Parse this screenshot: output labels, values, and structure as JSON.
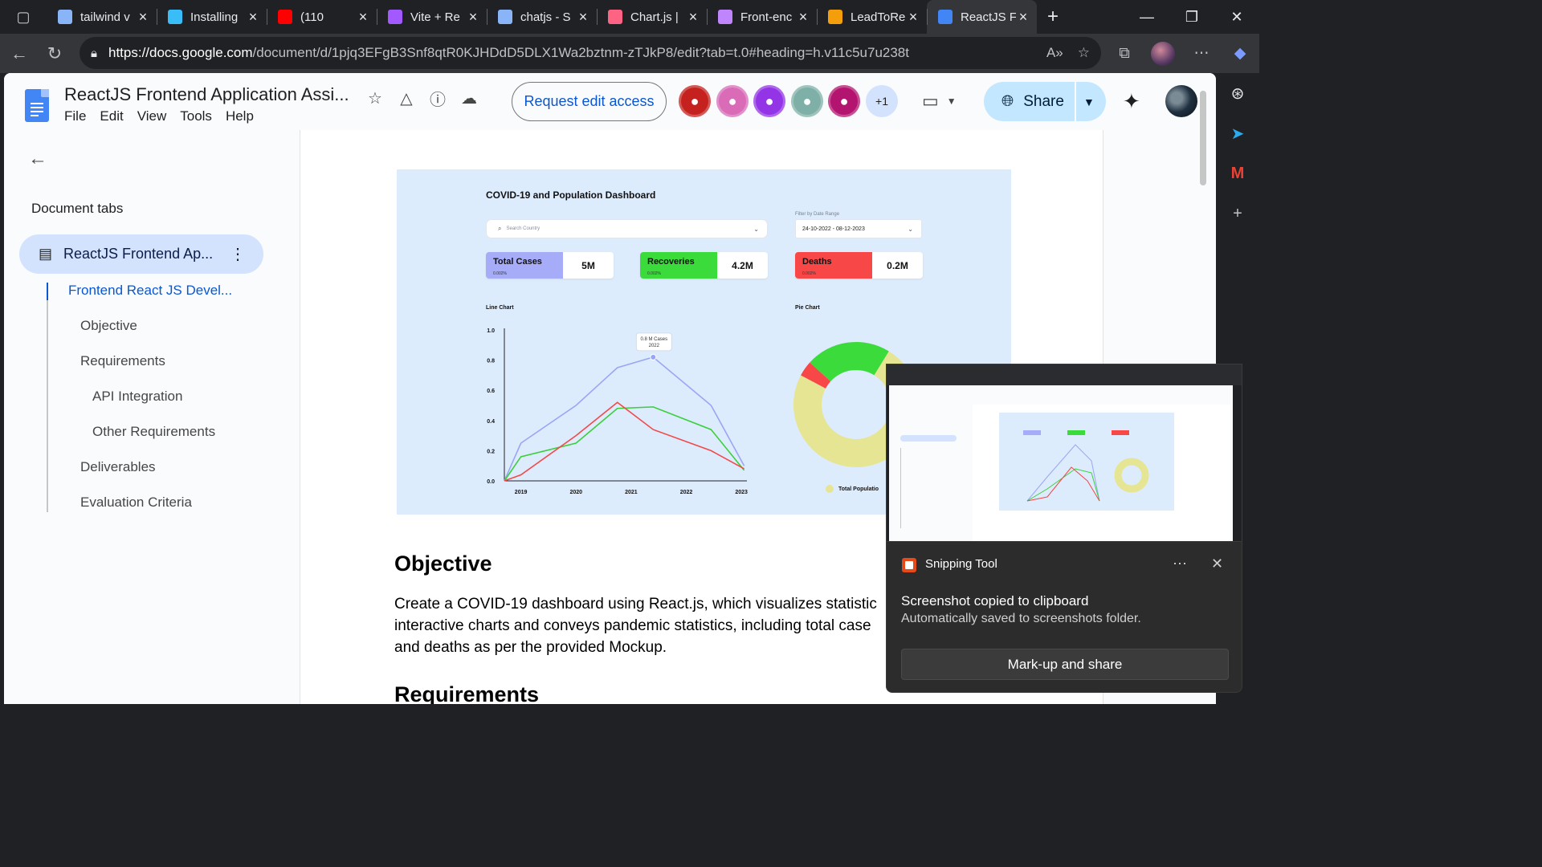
{
  "browser": {
    "tabs": [
      {
        "title": "tailwind v",
        "favicon": "search-icon",
        "color": "#8ab4f8",
        "active": false
      },
      {
        "title": "Installing",
        "favicon": "tailwind-icon",
        "color": "#38bdf8",
        "active": false
      },
      {
        "title": "(110",
        "favicon": "youtube-icon",
        "color": "#ff0000",
        "active": false
      },
      {
        "title": "Vite + Re",
        "favicon": "vite-icon",
        "color": "#a259ff",
        "active": false
      },
      {
        "title": "chatjs - S",
        "favicon": "search-icon",
        "color": "#8ab4f8",
        "active": false
      },
      {
        "title": "Chart.js |",
        "favicon": "chartjs-icon",
        "color": "#ff6384",
        "active": false
      },
      {
        "title": "Front-enc",
        "favicon": "frontend-icon",
        "color": "#c084fc",
        "active": false
      },
      {
        "title": "LeadToRe",
        "favicon": "leadtore-icon",
        "color": "#f59e0b",
        "active": false
      },
      {
        "title": "ReactJS F",
        "favicon": "docs-icon",
        "color": "#4285f4",
        "active": true
      }
    ],
    "url_host": "https://docs.google.com",
    "url_path": "/document/d/1pjq3EFgB3Snf8qtR0KJHDdD5DLX1Wa2bztnm-zTJkP8/edit?tab=t.0#heading=h.v11c5u7u238t"
  },
  "docs": {
    "title": "ReactJS Frontend Application Assi...",
    "menu": [
      "File",
      "Edit",
      "View",
      "Tools",
      "Help"
    ],
    "request_edit": "Request edit access",
    "extra_collaborators": "+1",
    "share_label": "Share",
    "avatar_colors": [
      "#c5221f",
      "#d96bb7",
      "#9334e6",
      "#7fb0a7",
      "#b3146f"
    ]
  },
  "sidebar": {
    "heading": "Document tabs",
    "tab_label": "ReactJS Frontend Ap...",
    "outline": [
      {
        "label": "Frontend React JS Devel...",
        "level": 1
      },
      {
        "label": "Objective",
        "level": 2
      },
      {
        "label": "Requirements",
        "level": 2
      },
      {
        "label": "API Integration",
        "level": 3
      },
      {
        "label": "Other Requirements",
        "level": 3
      },
      {
        "label": "Deliverables",
        "level": 2
      },
      {
        "label": "Evaluation Criteria",
        "level": 2
      }
    ]
  },
  "mockup": {
    "title": "COVID-19 and Population Dashboard",
    "search_placeholder": "Search Country",
    "filter_label": "Filter by Date Range",
    "filter_value": "24-10-2022 - 08-12-2023",
    "stats": [
      {
        "label": "Total Cases",
        "sub": "0.002%",
        "value": "5M",
        "color": "#a6acf8"
      },
      {
        "label": "Recoveries",
        "sub": "0.002%",
        "value": "4.2M",
        "color": "#3cdb3c"
      },
      {
        "label": "Deaths",
        "sub": "0.002%",
        "value": "0.2M",
        "color": "#f74747"
      }
    ],
    "line_title": "Line Chart",
    "pie_title": "Pie Chart",
    "tooltip_line1": "0.8 M Cases",
    "tooltip_line2": "2022",
    "pie_legend": "Total Populatio"
  },
  "chart_data": [
    {
      "type": "line",
      "title": "Line Chart",
      "x": [
        2018.8,
        2019,
        2019.6,
        2020,
        2020.6,
        2021,
        2021.5,
        2022,
        2022.5,
        2023.1
      ],
      "ylim": [
        0,
        1.0
      ],
      "yticks": [
        "0.0",
        "0.2",
        "0.4",
        "0.6",
        "0.8",
        "1.0"
      ],
      "xticks": [
        "2019",
        "2020",
        "2021",
        "2022",
        "2023"
      ],
      "series": [
        {
          "color": "#9aa6f5",
          "values": [
            0.0,
            0.25,
            0.5,
            0.75,
            0.82,
            0.5,
            0.1
          ]
        },
        {
          "color": "#3ccf3c",
          "values": [
            0.0,
            0.16,
            0.25,
            0.48,
            0.49,
            0.34,
            0.07
          ]
        },
        {
          "color": "#f44848",
          "values": [
            0.0,
            0.04,
            0.3,
            0.52,
            0.34,
            0.2,
            0.08
          ]
        }
      ],
      "series_x": [
        2018.7,
        2019,
        2020,
        2020.75,
        2021.4,
        2022.45,
        2023.05
      ]
    },
    {
      "type": "pie",
      "title": "Pie Chart",
      "slices": [
        {
          "color": "#e6e593",
          "value": 74
        },
        {
          "color": "#f74747",
          "value": 4
        },
        {
          "color": "#3cdb3c",
          "value": 22
        }
      ],
      "legend": [
        "Total Populatio"
      ]
    }
  ],
  "document": {
    "objective_heading": "Objective",
    "objective_lines": [
      "Create a COVID-19 dashboard using React.js, which visualizes statistic",
      "interactive charts and conveys pandemic statistics, including total case",
      "and deaths as per the provided Mockup."
    ],
    "requirements_heading": "Requirements"
  },
  "toast": {
    "app": "Snipping Tool",
    "title": "Screenshot copied to clipboard",
    "subtitle": "Automatically saved to screenshots folder.",
    "button": "Mark-up and share"
  }
}
